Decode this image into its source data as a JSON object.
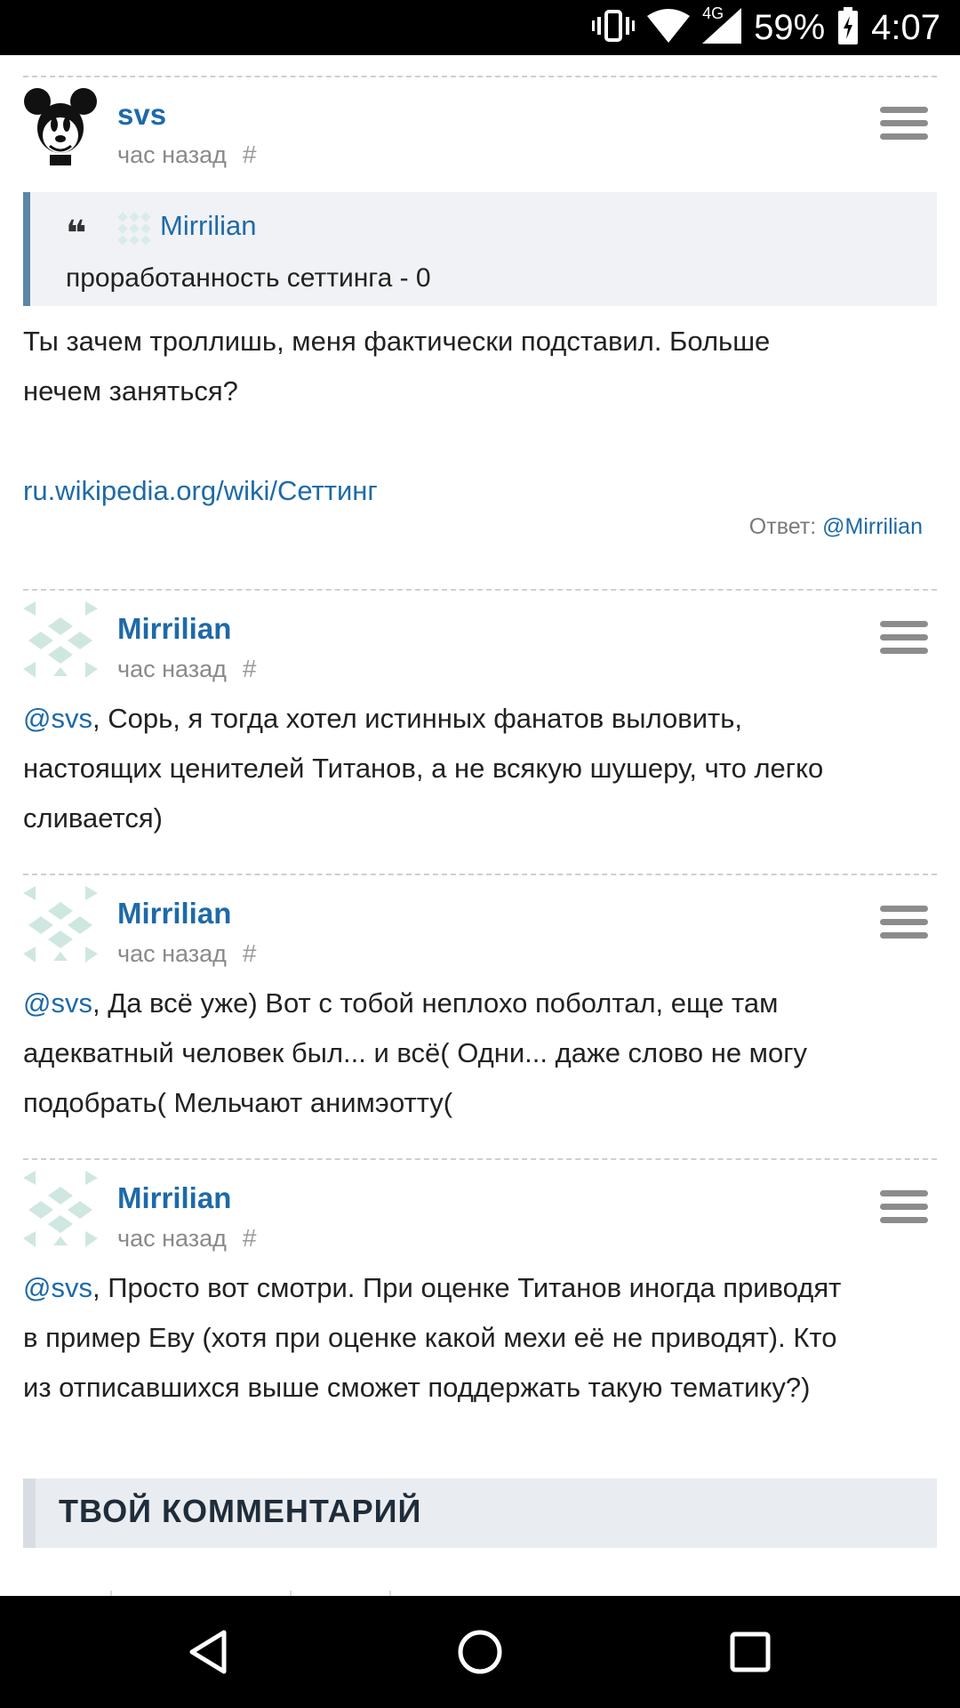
{
  "status_bar": {
    "network": "4G",
    "battery": "59%",
    "time": "4:07"
  },
  "comments": [
    {
      "author": "svs",
      "time": "час назад",
      "anchor": "#",
      "quote": {
        "author": "Mirrilian",
        "text": "проработанность сеттинга - 0"
      },
      "body_line1": "Ты зачем троллишь, меня фактически подставил. Больше",
      "body_line2": "нечем заняться?",
      "link": "ru.wikipedia.org/wiki/Сеттинг",
      "reply_label": "Ответ: ",
      "reply_mention": "@Mirrilian"
    },
    {
      "author": "Mirrilian",
      "time": "час назад",
      "anchor": "#",
      "mention": "@svs",
      "body_line1": ", Сорь, я тогда хотел истинных фанатов выловить,",
      "body_line2": "настоящих ценителей Титанов, а не всякую шушеру, что легко",
      "body_line3": "сливается)"
    },
    {
      "author": "Mirrilian",
      "time": "час назад",
      "anchor": "#",
      "mention": "@svs",
      "body_line1": ", Да всё уже) Вот с тобой неплохо поболтал, еще там",
      "body_line2": "адекватный человек был... и всё( Одни... даже слово не могу",
      "body_line3": "подобрать( Мельчают анимэотту("
    },
    {
      "author": "Mirrilian",
      "time": "час назад",
      "anchor": "#",
      "mention": "@svs",
      "body_line1": ", Просто вот смотри. При оценке Титанов иногда приводят",
      "body_line2": "в пример Еву (хотя при оценке какой мехи её не приводят). Кто",
      "body_line3": "из отписавшихся выше сможет поддержать такую тематику?)"
    }
  ],
  "comment_form": {
    "title": "ТВОЙ КОММЕНТАРИЙ"
  },
  "nav_bar": {
    "back": "back-icon",
    "home": "home-icon",
    "recents": "recents-icon"
  },
  "colors": {
    "link": "#1e6aa8",
    "quote_border": "#5a86a8",
    "status_bg": "#000000"
  }
}
